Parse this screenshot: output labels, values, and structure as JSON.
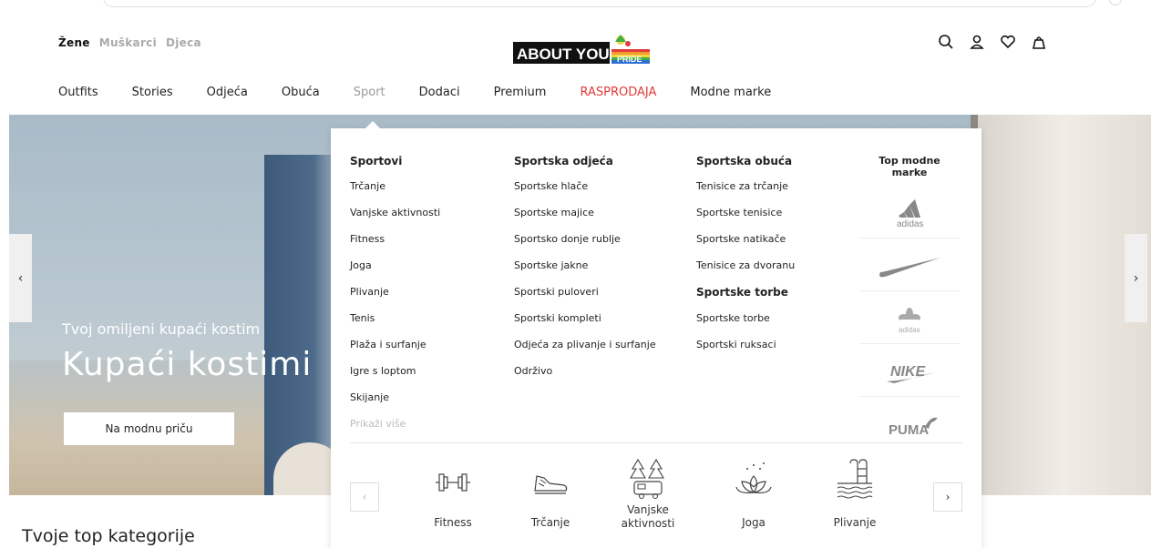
{
  "gender_tabs": [
    "Žene",
    "Muškarci",
    "Djeca"
  ],
  "logo": {
    "text": "ABOUT YOU",
    "badge": "PRIDE"
  },
  "nav": [
    {
      "label": "Outfits",
      "style": "normal"
    },
    {
      "label": "Stories",
      "style": "normal"
    },
    {
      "label": "Odjeća",
      "style": "normal"
    },
    {
      "label": "Obuća",
      "style": "normal"
    },
    {
      "label": "Sport",
      "style": "muted"
    },
    {
      "label": "Dodaci",
      "style": "normal"
    },
    {
      "label": "Premium",
      "style": "normal"
    },
    {
      "label": "RASPRODAJA",
      "style": "red"
    },
    {
      "label": "Modne marke",
      "style": "normal"
    }
  ],
  "hero": {
    "subtitle": "Tvoj omiljeni kupaći kostim",
    "title": "Kupaći kostimi",
    "cta": "Na modnu priču",
    "prev": "‹",
    "next": "›"
  },
  "mega": {
    "col1": {
      "heading": "Sportovi",
      "items": [
        "Trčanje",
        "Vanjske aktivnosti",
        "Fitness",
        "Joga",
        "Plivanje",
        "Tenis",
        "Plaža i surfanje",
        "Igre s loptom",
        "Skijanje"
      ],
      "more": "Prikaži više"
    },
    "col2": {
      "heading": "Sportska odjeća",
      "items": [
        "Sportske hlače",
        "Sportske majice",
        "Sportsko donje rublje",
        "Sportske jakne",
        "Sportski puloveri",
        "Sportski kompleti",
        "Odjeća za plivanje i surfanje",
        "Održivo"
      ]
    },
    "col3": {
      "heading": "Sportska obuća",
      "items": [
        "Tenisice za trčanje",
        "Sportske tenisice",
        "Sportske natikače",
        "Tenisice za dvoranu"
      ],
      "heading2": "Sportske torbe",
      "items2": [
        "Sportske torbe",
        "Sportski ruksaci"
      ]
    },
    "brands": {
      "heading": "Top modne marke",
      "items": [
        "adidas",
        "nike-swoosh",
        "adidas-originals",
        "NIKE",
        "PUMA"
      ],
      "adidas_label": "adidas",
      "originals_label": "adidas",
      "nike_label": "NIKE",
      "puma_label": "PUMA"
    },
    "carousel": {
      "prev": "‹",
      "next": "›",
      "sports": [
        {
          "label": "Fitness",
          "icon": "dumbbell-icon"
        },
        {
          "label": "Trčanje",
          "icon": "shoe-icon"
        },
        {
          "label": "Vanjske aktivnosti",
          "icon": "camper-icon"
        },
        {
          "label": "Joga",
          "icon": "lotus-icon"
        },
        {
          "label": "Plivanje",
          "icon": "pool-icon"
        }
      ]
    }
  },
  "top_categories": "Tvoje top kategorije",
  "colors": {
    "accent_red": "#e23a3a",
    "muted": "#999999"
  }
}
